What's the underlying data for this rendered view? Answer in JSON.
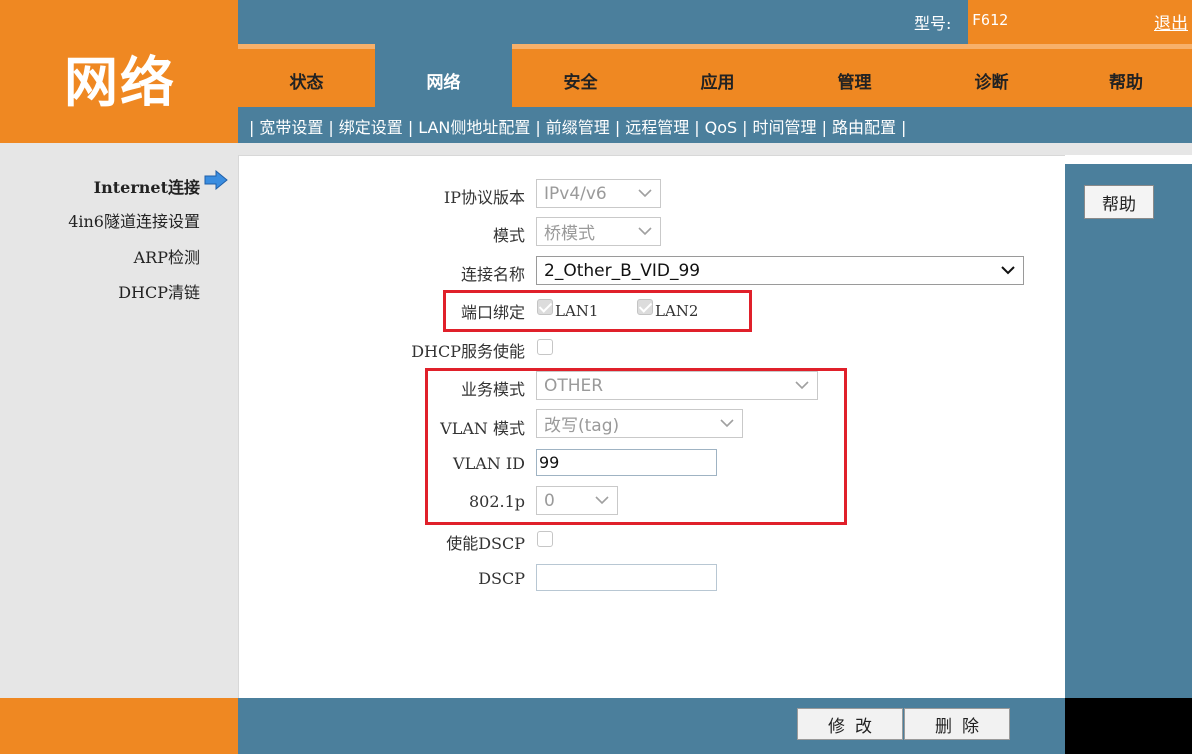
{
  "header": {
    "logo_text": "网络",
    "model_label": "型号:",
    "model_value": "F612",
    "logout_label": "退出"
  },
  "nav": {
    "tabs": [
      {
        "label": "状态"
      },
      {
        "label": "网络",
        "active": true
      },
      {
        "label": "安全"
      },
      {
        "label": "应用"
      },
      {
        "label": "管理"
      },
      {
        "label": "诊断"
      },
      {
        "label": "帮助"
      }
    ]
  },
  "subnav": {
    "items": [
      "宽带设置",
      "绑定设置",
      "LAN侧地址配置",
      "前缀管理",
      "远程管理",
      "QoS",
      "时间管理",
      "路由配置"
    ]
  },
  "sidebar": {
    "items": [
      {
        "label": "Internet连接",
        "active": true
      },
      {
        "label": "4in6隧道连接设置"
      },
      {
        "label": "ARP检测"
      },
      {
        "label": "DHCP清链"
      }
    ]
  },
  "help_button": "帮助",
  "form": {
    "ip_version": {
      "label": "IP协议版本",
      "value": "IPv4/v6"
    },
    "mode": {
      "label": "模式",
      "value": "桥模式"
    },
    "conn_name": {
      "label": "连接名称",
      "value": "2_Other_B_VID_99"
    },
    "port_bind": {
      "label": "端口绑定",
      "options": [
        "LAN1",
        "LAN2"
      ],
      "checked": [
        true,
        true
      ]
    },
    "dhcp_service": {
      "label": "DHCP服务使能",
      "checked": false
    },
    "service_mode": {
      "label": "业务模式",
      "value": "OTHER"
    },
    "vlan_mode": {
      "label": "VLAN 模式",
      "value": "改写(tag)"
    },
    "vlan_id": {
      "label": "VLAN ID",
      "value": "99"
    },
    "p8021": {
      "label": "802.1p",
      "value": "0"
    },
    "dscp_enable": {
      "label": "使能DSCP",
      "checked": false
    },
    "dscp": {
      "label": "DSCP",
      "value": ""
    }
  },
  "footer": {
    "modify_label": "修改",
    "delete_label": "删除"
  },
  "colors": {
    "orange": "#ef8822",
    "steel_blue": "#4b7f9c",
    "highlight_red": "#e0202a"
  }
}
